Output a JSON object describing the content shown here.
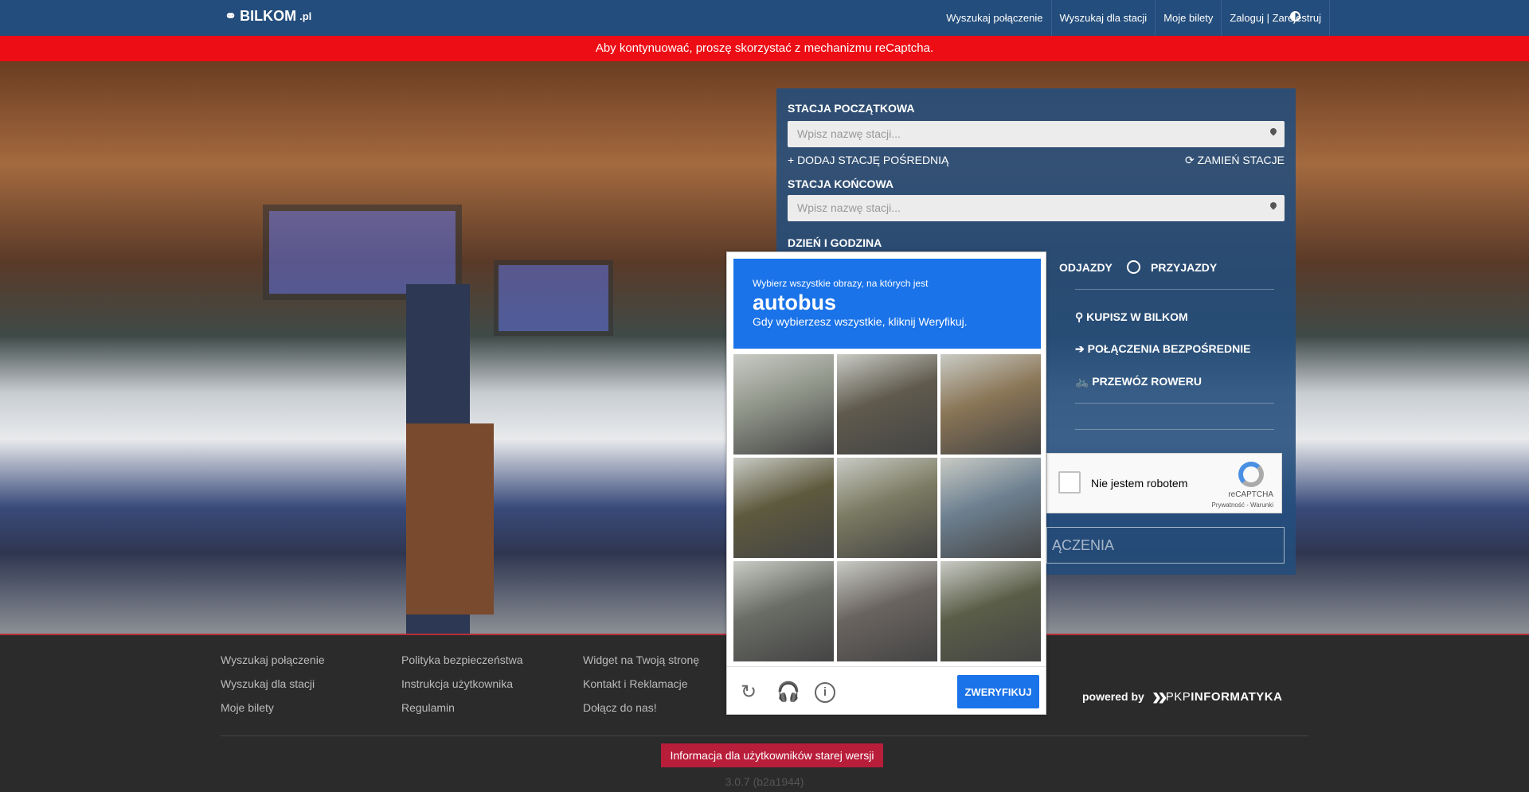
{
  "nav": {
    "logo": "BILKOM",
    "logo_suffix": ".pl",
    "links": [
      "Wyszukaj połączenie",
      "Wyszukaj dla stacji",
      "Moje bilety",
      "Zaloguj | Zarejestruj"
    ]
  },
  "alert": "Aby kontynuować, proszę skorzystać z mechanizmu reCaptcha.",
  "form": {
    "start_label": "STACJA POCZĄTKOWA",
    "start_placeholder": "Wpisz nazwę stacji...",
    "add_via": "+ DODAJ STACJĘ POŚREDNIĄ",
    "swap": "⟳ ZAMIEŃ STACJE",
    "end_label": "STACJA KOŃCOWA",
    "end_placeholder": "Wpisz nazwę stacji...",
    "datetime_label": "DZIEŃ I GODZINA",
    "departures": "ODJAZDY",
    "arrivals": "PRZYJAZDY",
    "options": [
      "KUPISZ W BILKOM",
      "POŁĄCZENIA BEZPOŚREDNIE",
      "PRZEWÓZ ROWERU"
    ],
    "search": "ĄCZENIA"
  },
  "recaptcha": {
    "checkbox_label": "Nie jestem robotem",
    "brand": "reCAPTCHA",
    "links": "Prywatność - Warunki"
  },
  "challenge": {
    "instruction": "Wybierz wszystkie obrazy, na których jest",
    "target": "autobus",
    "hint": "Gdy wybierzesz wszystkie, kliknij Weryfikuj.",
    "verify": "ZWERYFIKUJ",
    "tile_colors": [
      "#8f9488",
      "#5f5a4d",
      "#8a7556",
      "#5e5a3e",
      "#7b7a62",
      "#6d8090",
      "#6a6d66",
      "#6a6460",
      "#5a5e48"
    ]
  },
  "footer": {
    "col1": [
      "Wyszukaj połączenie",
      "Wyszukaj dla stacji",
      "Moje bilety"
    ],
    "col2": [
      "Polityka bezpieczeństwa",
      "Instrukcja użytkownika",
      "Regulamin"
    ],
    "col3": [
      "Widget na Twoją stronę",
      "Kontakt i Reklamacje",
      "Dołącz do nas!"
    ],
    "powered_by": "powered by",
    "pkp": "PKP",
    "informatyka": "INFORMATYKA",
    "old_version": "Informacja dla użytkowników starej wersji",
    "version": "3.0.7 (b2a1944)"
  }
}
